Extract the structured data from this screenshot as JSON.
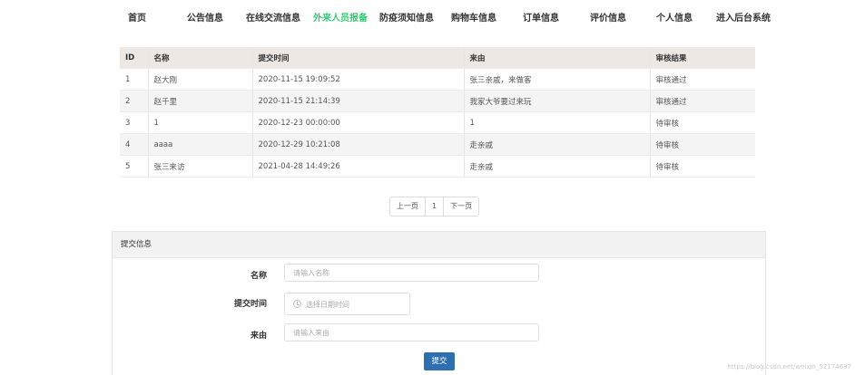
{
  "nav": {
    "items": [
      {
        "label": "首页"
      },
      {
        "label": "公告信息"
      },
      {
        "label": "在线交流信息"
      },
      {
        "label": "外来人员报备"
      },
      {
        "label": "防疫须知信息"
      },
      {
        "label": "购物车信息"
      },
      {
        "label": "订单信息"
      },
      {
        "label": "评价信息"
      },
      {
        "label": "个人信息"
      },
      {
        "label": "进入后台系统"
      }
    ],
    "active_color": "#2ecc71"
  },
  "table": {
    "headers": [
      "ID",
      "名称",
      "提交时间",
      "来由",
      "审核结果"
    ],
    "rows": [
      [
        "1",
        "赵大刚",
        "2020-11-15 19:09:52",
        "张三亲戚，来做客",
        "审核通过"
      ],
      [
        "2",
        "赵千里",
        "2020-11-15 21:14:39",
        "我家大爷要过来玩",
        "审核通过"
      ],
      [
        "3",
        "1",
        "2020-12-23 00:00:00",
        "1",
        "待审核"
      ],
      [
        "4",
        "aaaa",
        "2020-12-29 10:21:08",
        "走亲戚",
        "待审核"
      ],
      [
        "5",
        "张三来访",
        "2021-04-28 14:49:26",
        "走亲戚",
        "待审核"
      ]
    ]
  },
  "pager": {
    "prev": "上一页",
    "page": "1",
    "next": "下一页"
  },
  "form": {
    "title": "提交信息",
    "name_label": "名称",
    "name_placeholder": "请输入名称",
    "time_label": "提交时间",
    "time_placeholder": "选择日期时间",
    "reason_label": "来由",
    "reason_placeholder": "请输入来由",
    "submit_label": "提交"
  },
  "watermark": "https://blog.csdn.net/weixin_52174687",
  "colors": {
    "primary_button": "#2f6fb0",
    "table_header": "#ece8e6"
  }
}
